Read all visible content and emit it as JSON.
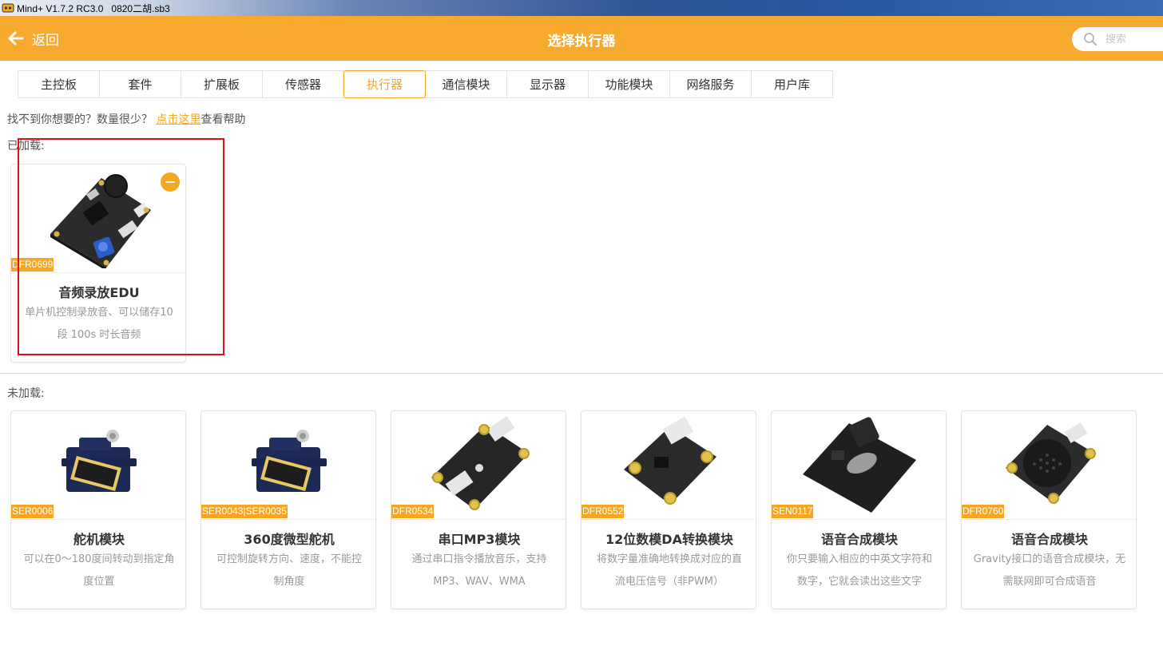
{
  "window": {
    "title": "Mind+ V1.7.2 RC3.0   0820二胡.sb3"
  },
  "header": {
    "back_label": "返回",
    "title": "选择执行器",
    "search_placeholder": "搜索"
  },
  "tabs": [
    {
      "label": "主控板",
      "active": false
    },
    {
      "label": "套件",
      "active": false
    },
    {
      "label": "扩展板",
      "active": false
    },
    {
      "label": "传感器",
      "active": false
    },
    {
      "label": "执行器",
      "active": true
    },
    {
      "label": "通信模块",
      "active": false
    },
    {
      "label": "显示器",
      "active": false
    },
    {
      "label": "功能模块",
      "active": false
    },
    {
      "label": "网络服务",
      "active": false
    },
    {
      "label": "用户库",
      "active": false
    }
  ],
  "help": {
    "prefix": "找不到你想要的？数量很少？ ",
    "link": "点击这里",
    "suffix": "查看帮助"
  },
  "loaded": {
    "label": "已加载:",
    "items": [
      {
        "sku": "DFR0699",
        "name": "音频录放EDU",
        "desc": "单片机控制录放音、可以储存10 段 100s 时长音频",
        "image": "audio-board"
      }
    ]
  },
  "unloaded": {
    "label": "未加载:",
    "items": [
      {
        "sku": "SER0006",
        "name": "舵机模块",
        "desc": "可以在0～180度间转动到指定角度位置",
        "image": "servo"
      },
      {
        "sku": "SER0043|SER0035",
        "name": "360度微型舵机",
        "desc": "可控制旋转方向、速度，不能控制角度",
        "image": "servo"
      },
      {
        "sku": "DFR0534",
        "name": "串口MP3模块",
        "desc": "通过串口指令播放音乐，支持MP3、WAV、WMA",
        "image": "mp3-board"
      },
      {
        "sku": "DFR0552",
        "name": "12位数模DA转换模块",
        "desc": "将数字量准确地转换成对应的直流电压信号（非PWM）",
        "image": "dac-board"
      },
      {
        "sku": "SEN0117",
        "name": "语音合成模块",
        "desc": "你只要输入相应的中英文字符和数字，它就会读出这些文字",
        "image": "speech-shield"
      },
      {
        "sku": "DFR0760",
        "name": "语音合成模块",
        "desc": "Gravity接口的语音合成模块，无需联网即可合成语音",
        "image": "speaker-board"
      }
    ]
  },
  "colors": {
    "accent": "#f8aa2f",
    "highlight": "#d9121a",
    "board": "#2a2a2a"
  }
}
